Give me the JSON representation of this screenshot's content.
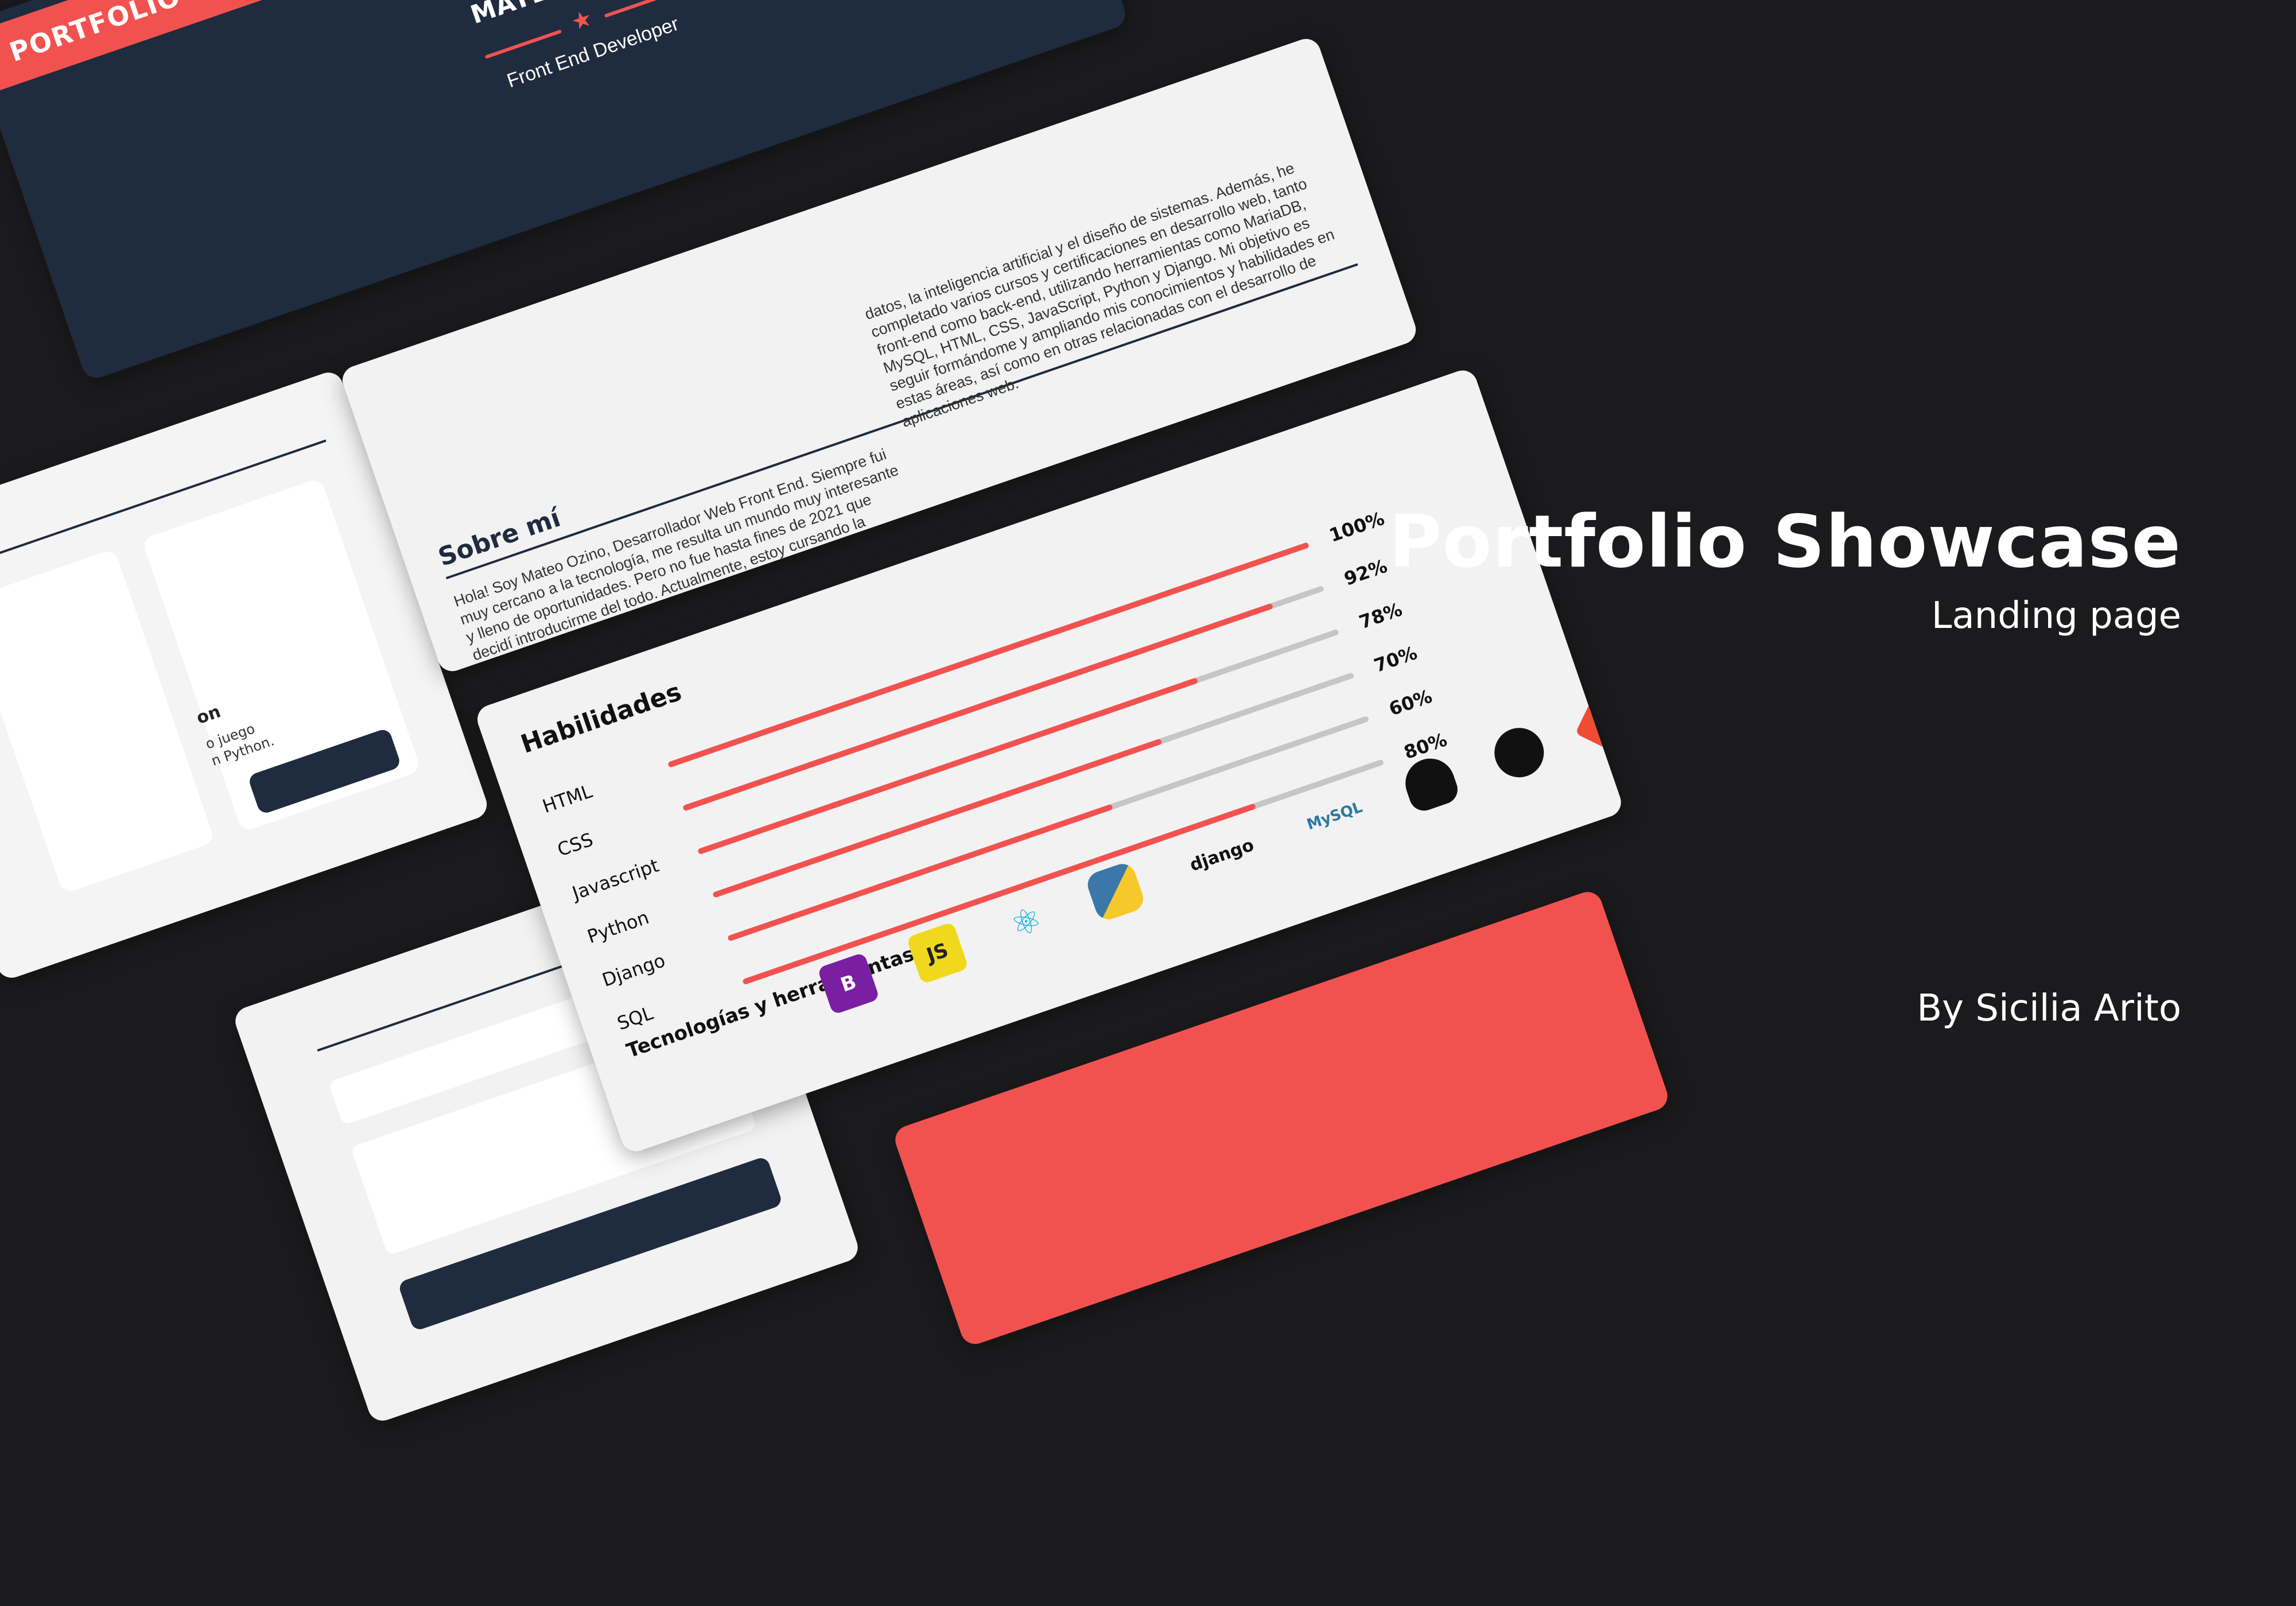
{
  "hero": {
    "ribbon": "PORTFOLIO WEB",
    "name": "MATEO OZINO",
    "role": "Front End Developer"
  },
  "about": {
    "title": "Sobre mí",
    "col1": "Hola! Soy Mateo Ozino, Desarrollador Web Front End. Siempre fui muy cercano a la tecnología, me resulta un mundo muy interesante y lleno de oportunidades. Pero no fue hasta fines de 2021 que decidí introducirme del todo. Actualmente, estoy cursando la licenciatura en ciencias de la computación en la Universidad de Buenos Aires, donde aprendo sobre los fundamentos teóricos y prácticos de la programación, el análisis de",
    "col2": "datos, la inteligencia artificial y el diseño de sistemas. Además, he completado varios cursos y certificaciones en desarrollo web, tanto front-end como back-end, utilizando herramientas como MariaDB, MySQL, HTML, CSS, JavaScript, Python y Django. Mi objetivo es seguir formándome y ampliando mis conocimientos y habilidades en estas áreas, así como en otras relacionadas con el desarrollo de aplicaciones web."
  },
  "skills": {
    "title": "Habilidades",
    "items": [
      {
        "name": "HTML",
        "pct_label": "100%",
        "level": 1.0
      },
      {
        "name": "CSS",
        "pct_label": "92%",
        "level": 0.92
      },
      {
        "name": "Javascript",
        "pct_label": "78%",
        "level": 0.78
      },
      {
        "name": "Python",
        "pct_label": "70%",
        "level": 0.7
      },
      {
        "name": "Django",
        "pct_label": "60%",
        "level": 0.6
      },
      {
        "name": "SQL",
        "pct_label": "80%",
        "level": 0.8
      }
    ],
    "tools_title": "Tecnologías y herramientas",
    "tools": [
      {
        "icon": "bootstrap-icon",
        "glyph": "B"
      },
      {
        "icon": "javascript-icon",
        "glyph": "JS"
      },
      {
        "icon": "react-icon",
        "glyph": "⚛"
      },
      {
        "icon": "python-icon",
        "glyph": ""
      },
      {
        "icon": "django-icon",
        "glyph": "django"
      },
      {
        "icon": "mysql-icon",
        "glyph": "MySQL"
      },
      {
        "icon": "linux-icon",
        "glyph": ""
      },
      {
        "icon": "github-icon",
        "glyph": ""
      },
      {
        "icon": "git-icon",
        "glyph": ""
      }
    ]
  },
  "left_card": {
    "heading": "on",
    "desc": "o juego\nn Python."
  },
  "showcase": {
    "title": "Portfolio Showcase",
    "subtitle": "Landing page",
    "byline": "By Sicilia Arito"
  },
  "colors": {
    "background": "#1b1b1d",
    "navy": "#1f2b3e",
    "accent": "#f2524f",
    "card": "#f2f2f2"
  }
}
